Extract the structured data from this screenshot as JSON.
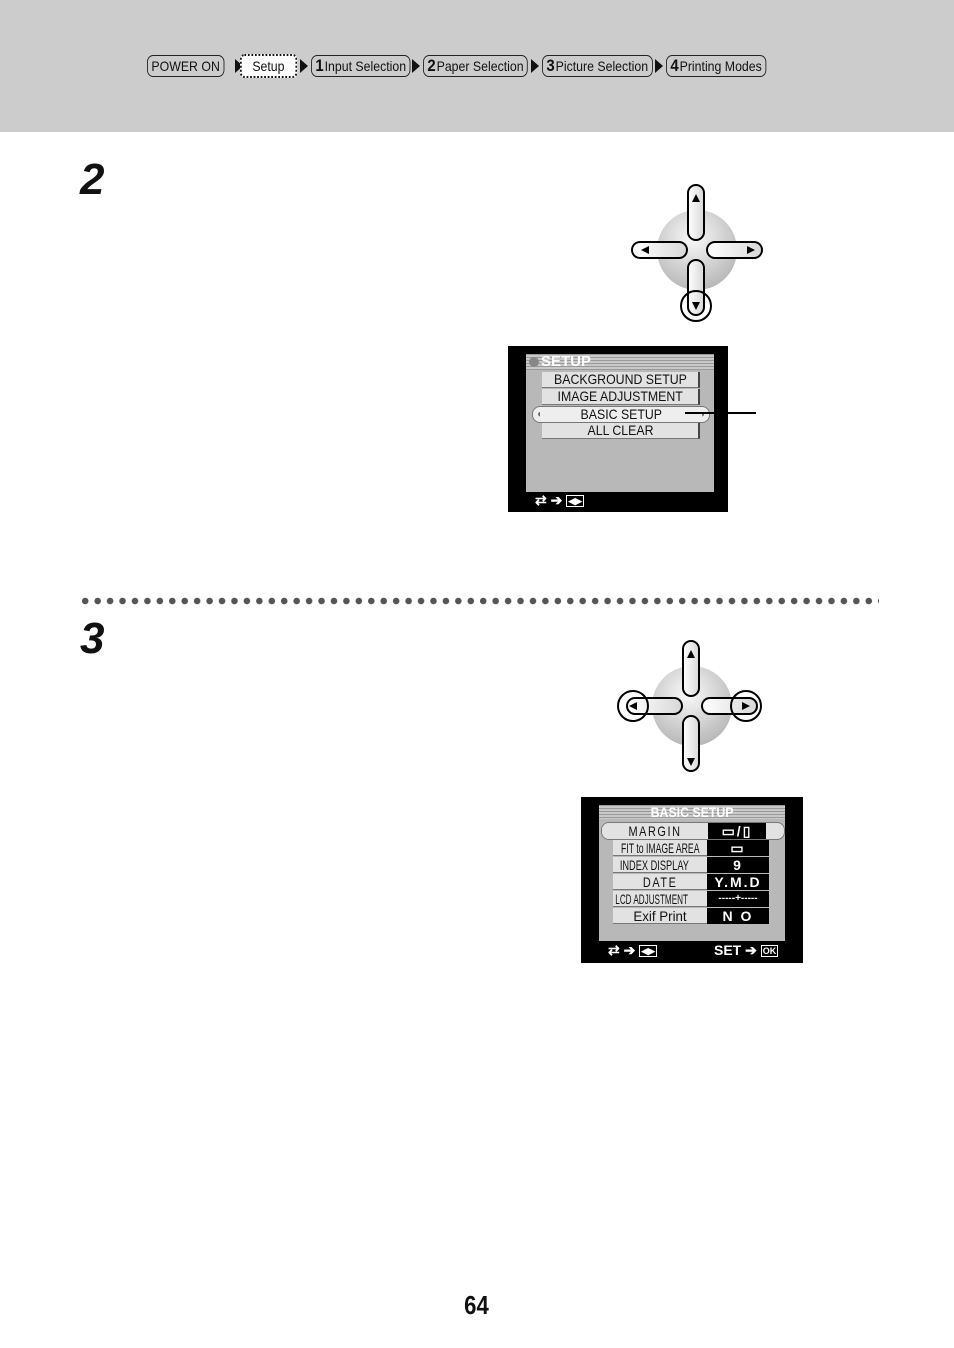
{
  "breadcrumb": {
    "items": [
      {
        "num": "",
        "label": "POWER ON",
        "current": false
      },
      {
        "num": "",
        "label": "Setup",
        "current": true
      },
      {
        "num": "1",
        "label": "Input Selection",
        "current": false
      },
      {
        "num": "2",
        "label": "Paper Selection",
        "current": false
      },
      {
        "num": "3",
        "label": "Picture Selection",
        "current": false
      },
      {
        "num": "4",
        "label": "Printing Modes",
        "current": false
      }
    ]
  },
  "steps": [
    {
      "number": "2",
      "dpad": {
        "highlighted": [
          "down"
        ],
        "icons": [
          "up-arrow",
          "down-arrow",
          "left-arrow",
          "right-arrow"
        ]
      },
      "screen": {
        "title": "SETUP",
        "items": [
          "BACKGROUND SETUP",
          "IMAGE ADJUSTMENT",
          "BASIC SETUP",
          "ALL CLEAR"
        ],
        "selected": "BASIC SETUP",
        "footer_left": "⇄ ➔ ◀▶"
      }
    },
    {
      "number": "3",
      "dpad": {
        "highlighted": [
          "left",
          "right"
        ],
        "icons": [
          "up-arrow",
          "down-arrow",
          "left-arrow",
          "right-arrow"
        ]
      },
      "screen": {
        "title": "BASIC SETUP",
        "rows": [
          {
            "label": "MARGIN",
            "value": "▭/▯"
          },
          {
            "label": "FIT to IMAGE AREA",
            "value": "▭"
          },
          {
            "label": "INDEX DISPLAY",
            "value": "9"
          },
          {
            "label": "DATE",
            "value": "Y.M.D"
          },
          {
            "label": "LCD ADJUSTMENT",
            "value": "-----+-----"
          },
          {
            "label": "Exif Print",
            "value": "N O"
          }
        ],
        "selected": "MARGIN",
        "footer_left": "⇄ ➔ ◀▶",
        "footer_right_label": "SET",
        "footer_right_key": "OK"
      }
    }
  ],
  "page_number": "64"
}
